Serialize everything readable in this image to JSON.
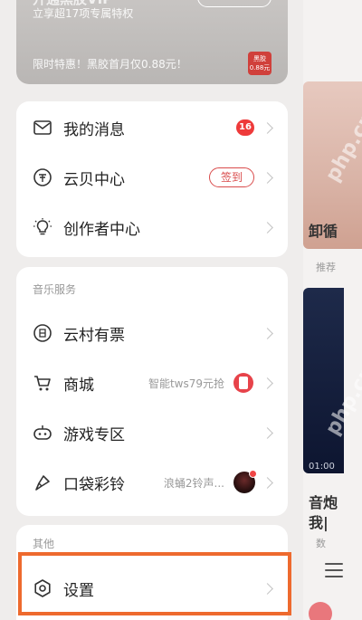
{
  "vip": {
    "title": "开通黑胶VIP",
    "subtitle": "立享超17项专属特权",
    "promo": "限时特惠！黑胶首月仅0.88元！",
    "badge": "黑胶 0.88元"
  },
  "account_menu": [
    {
      "label": "我的消息",
      "icon": "mail-icon",
      "badge_count": "16"
    },
    {
      "label": "云贝中心",
      "icon": "coin-icon",
      "action": "签到"
    },
    {
      "label": "创作者中心",
      "icon": "lightbulb-icon"
    }
  ],
  "music_services": {
    "title": "音乐服务",
    "items": [
      {
        "label": "云村有票",
        "icon": "ticket-icon"
      },
      {
        "label": "商城",
        "icon": "cart-icon",
        "extra": "智能tws79元抢"
      },
      {
        "label": "游戏专区",
        "icon": "gamepad-icon"
      },
      {
        "label": "口袋彩铃",
        "icon": "ringtone-icon",
        "extra": "浪蛹2铃声..."
      }
    ]
  },
  "other": {
    "title": "其他",
    "items": [
      {
        "label": "设置",
        "icon": "gear-icon"
      }
    ]
  },
  "background": {
    "text1": "卸循",
    "text1_sub": "推荐",
    "card_caption": "01:00",
    "text2": "音炮\n我|",
    "text2_sub": "数"
  },
  "watermark": "php.cn",
  "colors": {
    "accent_red": "#ee3a3a",
    "highlight_orange": "#ee6a2e"
  }
}
